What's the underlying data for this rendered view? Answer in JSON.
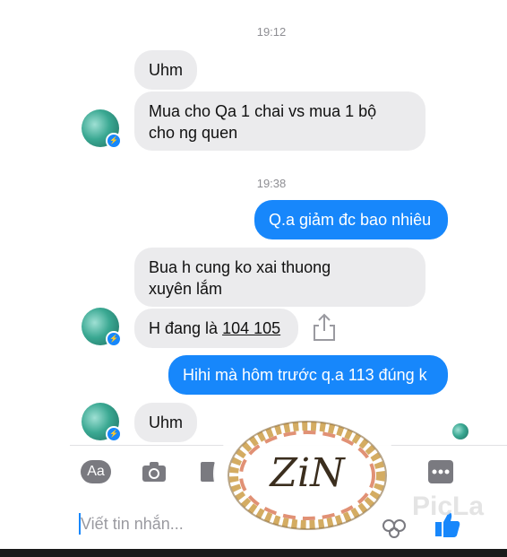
{
  "thread": {
    "timestamp_1": "19:12",
    "msg_1": "Uhm",
    "msg_2_line1": "Mua cho Qa 1 chai vs mua 1 bộ",
    "msg_2_line2": "cho ng quen",
    "timestamp_2": "19:38",
    "msg_3": "Q.a giảm đc bao nhiêu",
    "msg_4_line1": "Bua h cung ko xai thuong",
    "msg_4_line2": "xuyên lắm",
    "msg_5_prefix": "H đang là ",
    "msg_5_link": "104 105",
    "msg_6": "Hihi mà hôm trước q.a 113 đúng k",
    "msg_7": "Uhm"
  },
  "toolbar": {
    "aa_label": "Aa"
  },
  "composer": {
    "placeholder": "Viết tin nhắn..."
  },
  "watermark": {
    "logo_text": "ZiN",
    "picla_text": "PicLa"
  },
  "colors": {
    "accent": "#1787fb",
    "incoming": "#ebebed"
  }
}
